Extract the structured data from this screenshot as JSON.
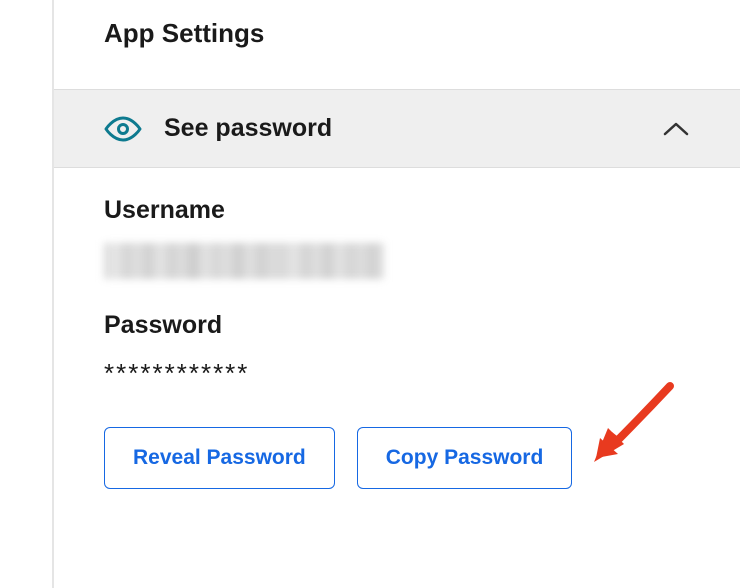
{
  "header": {
    "title": "App Settings"
  },
  "accordion": {
    "title": "See password"
  },
  "fields": {
    "username_label": "Username",
    "password_label": "Password",
    "password_masked": "************"
  },
  "buttons": {
    "reveal": "Reveal Password",
    "copy": "Copy Password"
  },
  "colors": {
    "accent": "#1668e3",
    "eye": "#0d7a8f",
    "arrow": "#e83a1f"
  }
}
